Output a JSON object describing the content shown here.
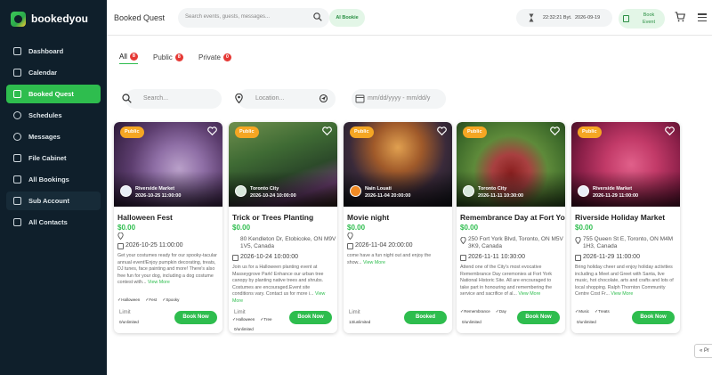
{
  "brand": {
    "name": "bookedyou"
  },
  "sidebar": {
    "items": [
      {
        "label": "Dashboard"
      },
      {
        "label": "Calendar"
      },
      {
        "label": "Booked Quest"
      },
      {
        "label": "Schedules"
      },
      {
        "label": "Messages"
      },
      {
        "label": "File Cabinet"
      },
      {
        "label": "All Bookings"
      },
      {
        "label": "Sub Account"
      },
      {
        "label": "All Contacts"
      }
    ]
  },
  "header": {
    "title": "Booked Quest",
    "search_placeholder": "Search events, guests, messages...",
    "ai_label": "AI Bookie",
    "time": "22:32:21 Byt.",
    "date": "2026-09-19",
    "book_event_label": "Book Event"
  },
  "tabs": [
    {
      "label": "All",
      "count": "8"
    },
    {
      "label": "Public",
      "count": "8"
    },
    {
      "label": "Private",
      "count": "0"
    }
  ],
  "filters": {
    "search_placeholder": "Search...",
    "location_placeholder": "Location...",
    "date_placeholder": "mm/dd/yyyy - mm/dd/y"
  },
  "cards": [
    {
      "badge": "Public",
      "host": "Riverside Market",
      "host_datetime": "2026-10-25 11:00:00",
      "title": "Halloween Fest",
      "price": "$0.00",
      "location": "",
      "date": "2026-10-25 11:00:00",
      "description": "Get your costumes ready for our spooky-tacular annual event!Enjoy pumpkin decorating, treats, DJ tunes, face painting and more! There's also free fun for your dog, including a dog costume contest with...",
      "view_more": "View More",
      "tags": [
        "Halloween",
        "Fest",
        "Spooky"
      ],
      "limit_label": "Limit",
      "limit_value": "0/unlimited",
      "action": "Book Now"
    },
    {
      "badge": "Public",
      "host": "Toronto City",
      "host_datetime": "2026-10-24 10:00:00",
      "title": "Trick or Trees Planting",
      "price": "$0.00",
      "location": "80 Kendleton Dr, Etobicoke, ON M9V 1V5, Canada",
      "date": "2026-10-24 10:00:00",
      "description": "Join us for a Halloween planting event at Masseygrove Park! Enhance our urban tree canopy by planting native trees and shrubs. Costumes are encouraged.Event site conditions vary. Contact us for more i...",
      "view_more": "View More",
      "tags": [
        "Halloween",
        "Tree"
      ],
      "limit_label": "Limit",
      "limit_value": "0/unlimited",
      "action": "Book Now"
    },
    {
      "badge": "Public",
      "host": "Nain Louati",
      "host_datetime": "2026-11-04 20:00:00",
      "title": "Movie night",
      "price": "$0.00",
      "location": "",
      "date": "2026-11-04 20:00:00",
      "description": "come have a fun night out and enjoy the show...",
      "view_more": "View More",
      "tags": [],
      "limit_label": "Limit",
      "limit_value": "13/unlimited",
      "action": "Booked"
    },
    {
      "badge": "Public",
      "host": "Toronto City",
      "host_datetime": "2026-11-11 10:30:00",
      "title": "Remembrance Day at Fort York",
      "price": "$0.00",
      "location": "250 Fort York Blvd, Toronto, ON M5V 3K9, Canada",
      "date": "2026-11-11 10:30:00",
      "description": "Attend one of the City's most evocative Remembrance Day ceremonies at Fort York National Historic Site. All are encouraged to take part in honouring and remembering the service and sacrifice of al...",
      "view_more": "View More",
      "tags": [
        "Remembrance",
        "Day"
      ],
      "limit_label": "Limit",
      "limit_value": "0/unlimited",
      "action": "Book Now"
    },
    {
      "badge": "Public",
      "host": "Riverside Market",
      "host_datetime": "2026-11-29 11:00:00",
      "title": "Riverside Holiday Market",
      "price": "$0.00",
      "location": "755 Queen St E, Toronto, ON M4M 1H3, Canada",
      "date": "2026-11-29 11:00:00",
      "description": "Bring holiday cheer and enjoy holiday activities including a Meet and Greet with Santa, live music, hot chocolate, arts and crafts and lots of local shopping. Ralph Thornton Community Centre Cost Fr...",
      "view_more": "View More",
      "tags": [
        "Music",
        "Treats"
      ],
      "limit_label": "Limit",
      "limit_value": "0/unlimited",
      "action": "Book Now"
    }
  ],
  "pagination": {
    "prev": "« Pr"
  },
  "colors": {
    "accent": "#2ebd4e",
    "sidebar": "#0f1f2b",
    "badge": "#f5a623"
  }
}
